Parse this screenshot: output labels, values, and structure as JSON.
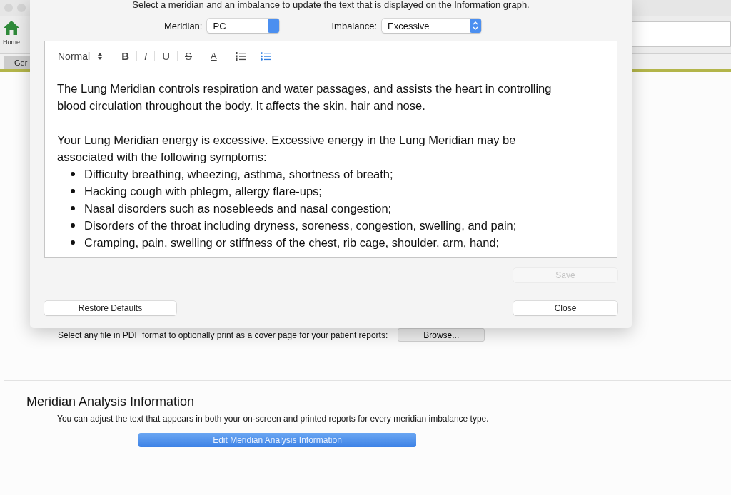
{
  "app": {
    "toolbar": {
      "home_label": "Home"
    },
    "tabs": [
      {
        "label": "Ger",
        "selected": true
      }
    ],
    "sections": [
      {
        "kind": "cover",
        "text": "Select any file in PDF format to optionally print as a cover page for your patient reports:",
        "button": "Browse..."
      },
      {
        "kind": "meridian",
        "heading": "Meridian Analysis Information",
        "text": "You can adjust the text that appears in both your on-screen and printed reports for every meridian imbalance type.",
        "button": "Edit Meridian Analysis Information"
      }
    ]
  },
  "dialog": {
    "instruction": "Select a meridian and an imbalance to update the text that is displayed on the Information graph.",
    "meridian": {
      "label": "Meridian:",
      "value": "PC"
    },
    "imbalance": {
      "label": "Imbalance:",
      "value": "Excessive"
    },
    "editor": {
      "toolbar": [
        {
          "kind": "style",
          "label": "Normal",
          "active": false
        },
        {
          "kind": "bold",
          "label": "B",
          "active": false
        },
        {
          "kind": "italic",
          "label": "I",
          "active": false
        },
        {
          "kind": "underline",
          "label": "U",
          "active": false
        },
        {
          "kind": "strike",
          "label": "S",
          "active": false
        },
        {
          "kind": "color",
          "label": "A",
          "active": false
        },
        {
          "kind": "ordered",
          "active": false
        },
        {
          "kind": "bullet",
          "active": true
        }
      ],
      "content": [
        {
          "kind": "paragraph",
          "text": "The Lung Meridian controls respiration and water passages, and assists the heart in controlling blood circulation throughout the body. It affects the skin, hair and nose."
        },
        {
          "kind": "paragraph",
          "text": "Your Lung Meridian energy is excessive. Excessive energy in the Lung Meridian may be associated with the following symptoms:"
        },
        {
          "kind": "list",
          "items": [
            "Difficulty breathing, wheezing, asthma, shortness of breath;",
            "Hacking cough with phlegm, allergy flare-ups;",
            "Nasal disorders such as nosebleeds and nasal congestion;",
            "Disorders of the throat including dryness, soreness, congestion, swelling, and pain;",
            "Cramping, pain, swelling or stiffness of the chest, rib cage, shoulder, arm, hand;"
          ]
        }
      ]
    },
    "buttons": [
      {
        "kind": "save",
        "label": "Save",
        "disabled": true
      },
      {
        "kind": "restore",
        "label": "Restore Defaults",
        "disabled": false
      },
      {
        "kind": "close",
        "label": "Close",
        "disabled": false
      }
    ]
  }
}
